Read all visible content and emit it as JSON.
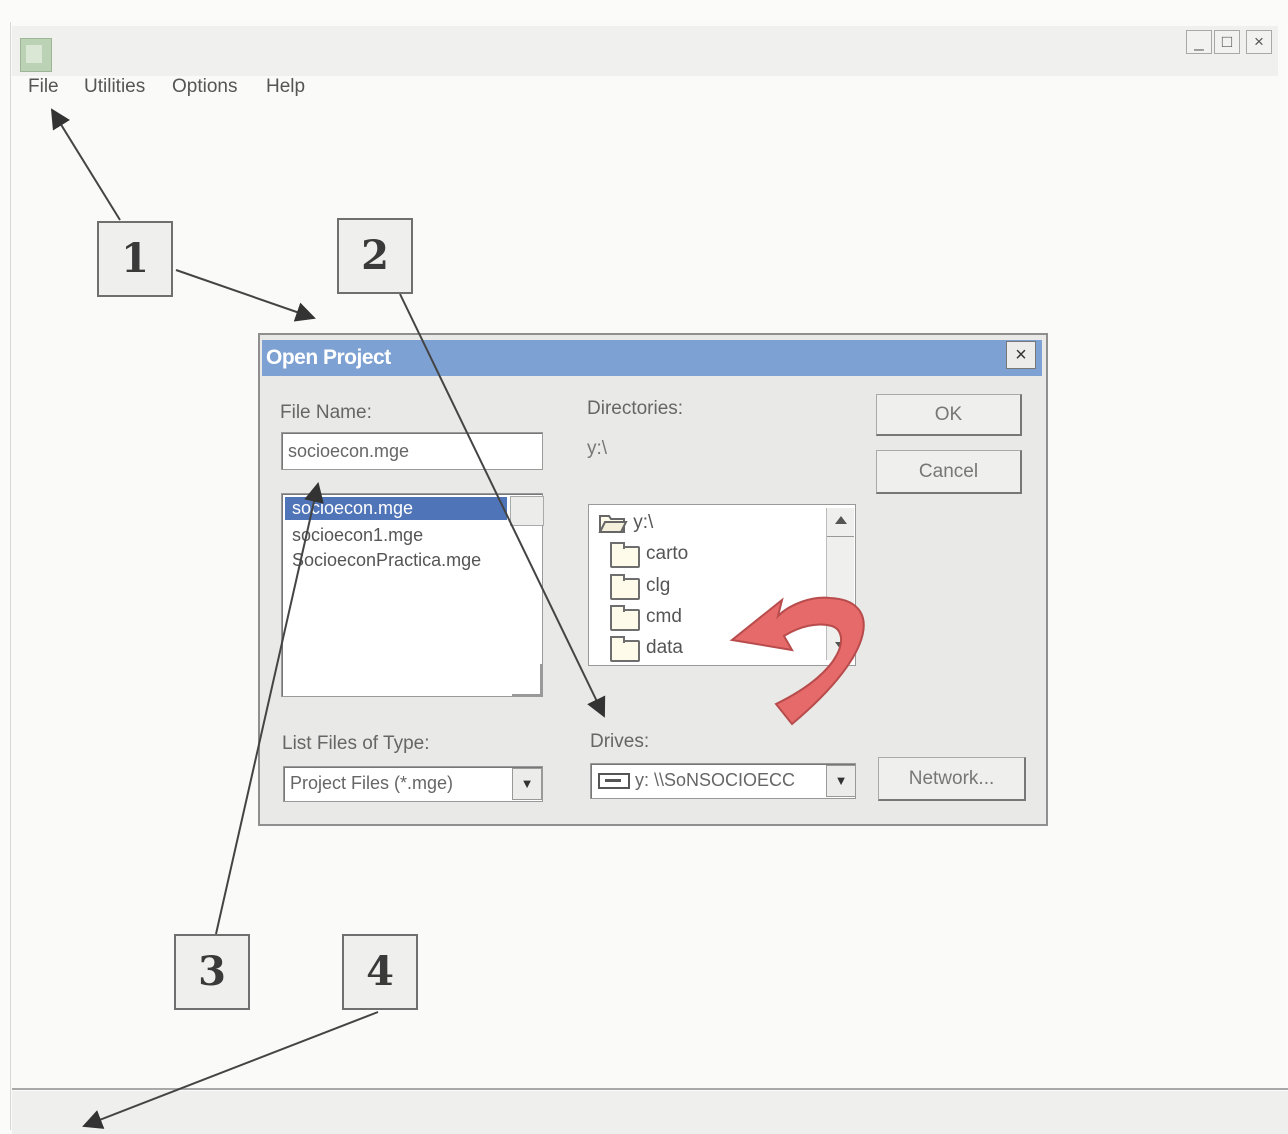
{
  "window": {
    "controls": {
      "minimize": "_",
      "maximize": "□",
      "close": "×"
    }
  },
  "menubar": {
    "items": [
      {
        "label": "File"
      },
      {
        "label": "Utilities"
      },
      {
        "label": "Options"
      },
      {
        "label": "Help"
      }
    ]
  },
  "dialog": {
    "title": "Open Project",
    "close_label": "×",
    "file_name_label": "File Name:",
    "file_name_value": "socioecon.mge",
    "files": [
      "socioecon.mge",
      "socioecon1.mge",
      "SocioeconPractica.mge"
    ],
    "directories_label": "Directories:",
    "current_directory": "y:\\",
    "directory_root": "y:\\",
    "directories": [
      "carto",
      "clg",
      "cmd",
      "data"
    ],
    "list_type_label": "List Files of Type:",
    "list_type_value": "Project Files (*.mge)",
    "drives_label": "Drives:",
    "drives_value": "y: \\\\SoNSOCIOECC",
    "ok_label": "OK",
    "cancel_label": "Cancel",
    "network_label": "Network..."
  },
  "callouts": [
    "1",
    "2",
    "3",
    "4"
  ],
  "colors": {
    "dialog_title_bar": "#7ea1d3",
    "selection": "#4f74b8",
    "curved_arrow": "#e76a6a"
  },
  "icons": [
    "app-icon",
    "folder-open-icon",
    "folder-icon",
    "drive-icon",
    "curved-arrow-icon",
    "pointer-arrow-icon"
  ]
}
